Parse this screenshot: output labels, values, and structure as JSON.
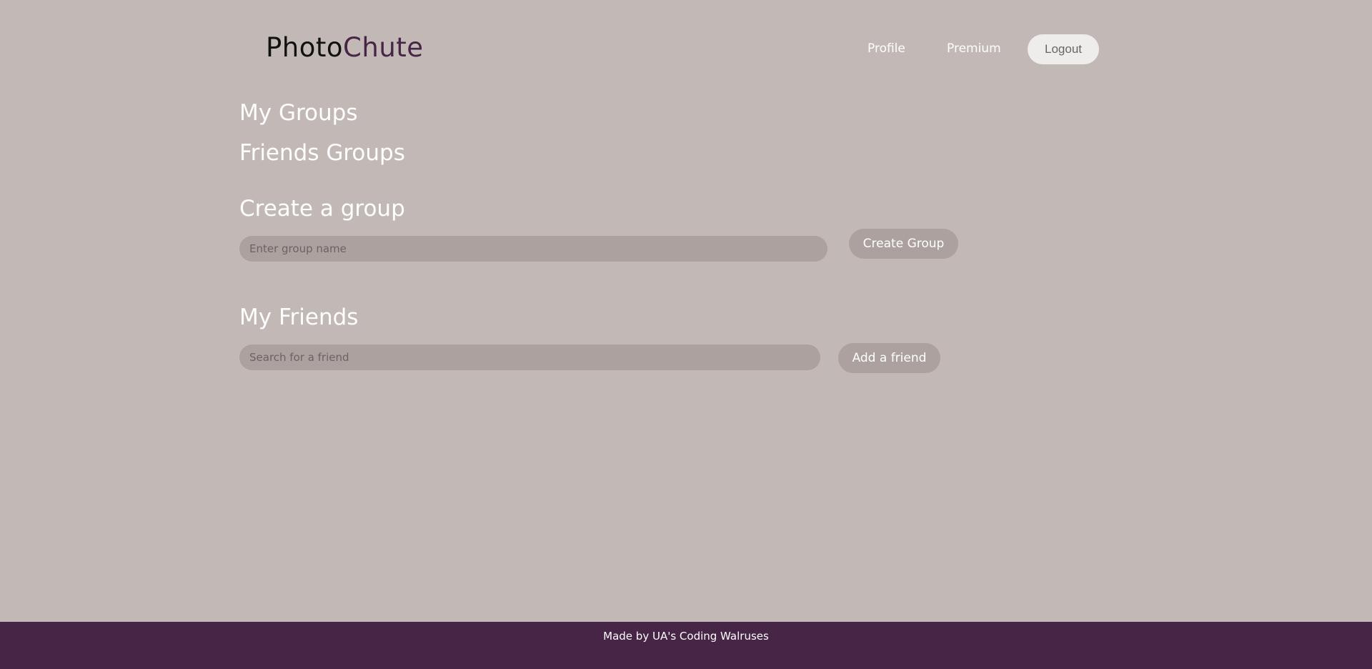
{
  "header": {
    "logo_part1": "Photo",
    "logo_part2": "Chute",
    "nav": {
      "profile": "Profile",
      "premium": "Premium",
      "logout": "Logout"
    }
  },
  "main": {
    "my_groups": "My Groups",
    "friends_groups": "Friends Groups",
    "create_group": {
      "heading": "Create a group",
      "placeholder": "Enter group name",
      "button": "Create Group"
    },
    "my_friends": {
      "heading": "My Friends",
      "placeholder": "Search for a friend",
      "button": "Add a friend"
    }
  },
  "footer": {
    "text": "Made by UA's Coding Walruses"
  },
  "colors": {
    "background": "#c2b8b5",
    "brand_purple": "#472547",
    "input_bg": "#ada19f",
    "logout_bg": "#efecec"
  }
}
